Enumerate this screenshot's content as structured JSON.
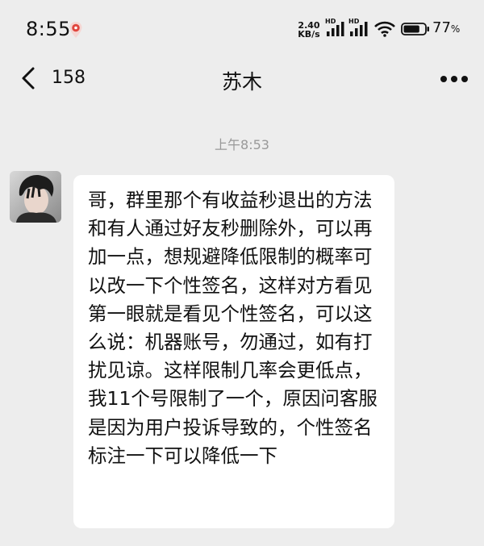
{
  "status_bar": {
    "time": "8:55",
    "network_speed_value": "2.40",
    "network_speed_unit": "KB/s",
    "sim1_label": "HD",
    "sim2_label": "HD",
    "battery_value": "77",
    "battery_unit": "%",
    "battery_level": 0.77,
    "icons": [
      "location-pin-icon",
      "signal-icon",
      "wifi-icon",
      "battery-icon"
    ]
  },
  "nav": {
    "unread_count": "158",
    "title": "苏木",
    "icons": [
      "chevron-left-icon",
      "more-dots-icon"
    ]
  },
  "chat": {
    "timestamp": "上午8:53",
    "messages": [
      {
        "text": "哥，群里那个有收益秒退出的方法和有人通过好友秒删除外，可以再加一点，想规避降低限制的概率可以改一下个性签名，这样对方看见第一眼就是看见个性签名，可以这么说：机器账号，勿通过，如有打扰见谅。这样限制几率会更低点，我11个号限制了一个，原因问客服是因为用户投诉导致的，个性签名标注一下可以降低一下"
      }
    ]
  },
  "colors": {
    "background": "#ededed",
    "bubble": "#ffffff",
    "timestamp": "#999999",
    "location_pin": "#e0473f"
  }
}
